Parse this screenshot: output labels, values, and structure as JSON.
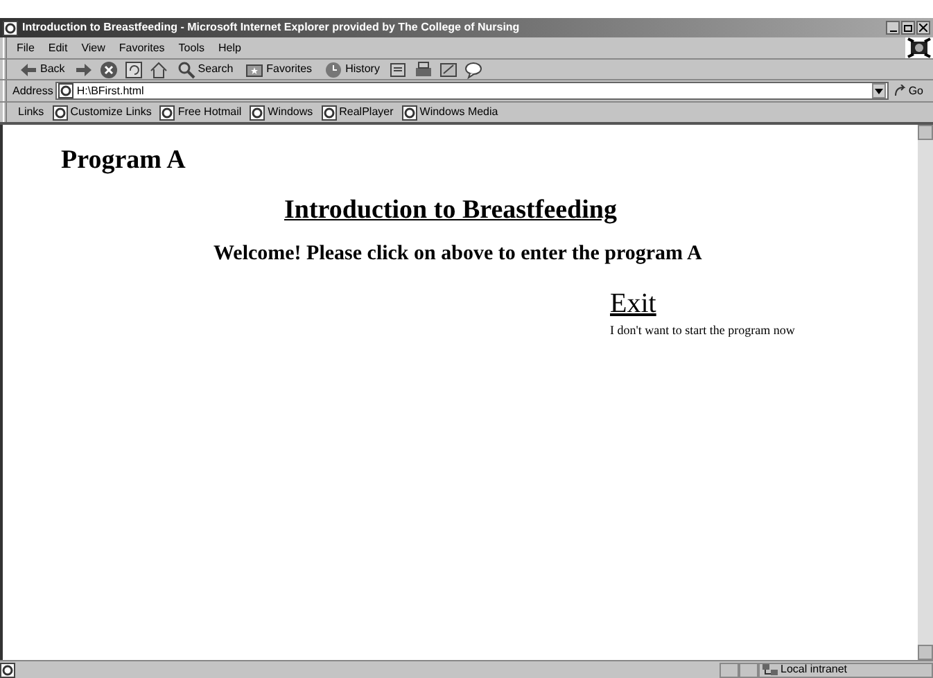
{
  "window": {
    "title": "Introduction to Breastfeeding - Microsoft Internet Explorer provided by The College of Nursing"
  },
  "menu": [
    "File",
    "Edit",
    "View",
    "Favorites",
    "Tools",
    "Help"
  ],
  "toolbar": [
    {
      "kind": "back",
      "label": "Back"
    },
    {
      "kind": "forward"
    },
    {
      "kind": "stop"
    },
    {
      "kind": "refresh"
    },
    {
      "kind": "home"
    },
    {
      "kind": "search",
      "label": "Search"
    },
    {
      "kind": "favorites",
      "label": "Favorites"
    },
    {
      "kind": "history",
      "label": "History"
    },
    {
      "kind": "mail"
    },
    {
      "kind": "print"
    },
    {
      "kind": "edit"
    },
    {
      "kind": "discuss"
    }
  ],
  "address": {
    "label": "Address",
    "value": "H:\\BFirst.html",
    "go": "Go"
  },
  "links": {
    "label": "Links",
    "items": [
      "Customize Links",
      "Free Hotmail",
      "Windows",
      "RealPlayer",
      "Windows Media"
    ]
  },
  "page": {
    "heading": "Program A",
    "link": "Introduction to Breastfeeding",
    "welcome": "Welcome! Please click on above to enter the program A",
    "exit": "Exit",
    "exit_note": "I don't want to start the program now"
  },
  "status_bar": {
    "zone": "Local intranet"
  }
}
